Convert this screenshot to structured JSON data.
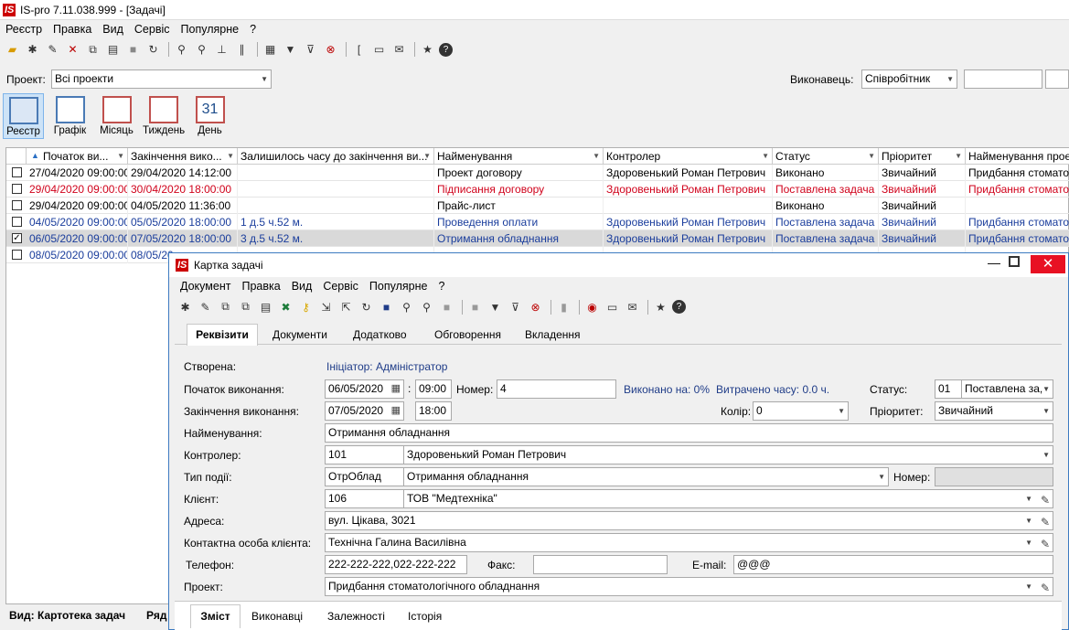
{
  "app": {
    "title": "IS-pro 7.11.038.999 - [Задачі]",
    "logo": "IS"
  },
  "menu": [
    "Реєстр",
    "Правка",
    "Вид",
    "Сервіс",
    "Популярне",
    "?"
  ],
  "toolbar_icons": [
    "new-folder-icon",
    "new-doc-icon",
    "edit-icon",
    "delete-icon",
    "copy-icon",
    "print-icon",
    "save-icon",
    "refresh-icon",
    "find-icon",
    "find-next-icon",
    "tree-icon",
    "attach-icon",
    "table-icon",
    "filter-icon",
    "filter-clear-icon",
    "filter-off-icon",
    "bracket-icon",
    "card-icon",
    "mail-icon",
    "star-icon",
    "help-icon"
  ],
  "filter": {
    "project_label": "Проект:",
    "project_value": "Всі проекти",
    "executor_label": "Виконавець:",
    "executor_value": "Співробітник"
  },
  "views": [
    "Реєстр",
    "Графік",
    "Місяць",
    "Тиждень",
    "День"
  ],
  "day_number": "31",
  "grid": {
    "headers": [
      "Початок ви...",
      "Закінчення вико...",
      "Залишилось часу до закінчення ви...",
      "Найменування",
      "Контролер",
      "Статус",
      "Пріоритет",
      "Найменування проект"
    ],
    "rows": [
      {
        "color": "#000000",
        "checked": "",
        "cells": [
          "27/04/2020 09:00:00",
          "29/04/2020 14:12:00",
          "",
          "Проект договору",
          "Здоровенький Роман Петрович",
          "Виконано",
          "Звичайний",
          "Придбання стоматоло"
        ]
      },
      {
        "color": "#d0021b",
        "checked": "",
        "cells": [
          "29/04/2020 09:00:00",
          "30/04/2020 18:00:00",
          "",
          "Підписання договору",
          "Здоровенький Роман Петрович",
          "Поставлена задача",
          "Звичайний",
          "Придбання стоматоло"
        ]
      },
      {
        "color": "#000000",
        "checked": "",
        "cells": [
          "29/04/2020 09:00:00",
          "04/05/2020 11:36:00",
          "",
          "Прайс-лист",
          "",
          "Виконано",
          "Звичайний",
          ""
        ]
      },
      {
        "color": "#1a3d9c",
        "checked": "",
        "cells": [
          "04/05/2020 09:00:00",
          "05/05/2020 18:00:00",
          "1 д.5 ч.52 м.",
          "Проведення оплати",
          "Здоровенький Роман Петрович",
          "Поставлена задача",
          "Звичайний",
          "Придбання стоматоло"
        ]
      },
      {
        "color": "#1a3d9c",
        "checked": "✓",
        "cells": [
          "06/05/2020 09:00:00",
          "07/05/2020 18:00:00",
          "3 д.5 ч.52 м.",
          "Отримання обладнання",
          "Здоровенький Роман Петрович",
          "Поставлена задача",
          "Звичайний",
          "Придбання стоматоло"
        ]
      },
      {
        "color": "#1a3d9c",
        "checked": "",
        "cells": [
          "08/05/2020 09:00:00",
          "08/05/20",
          "",
          "",
          "",
          "",
          "",
          ""
        ]
      }
    ],
    "footer_left": "Вид: Картотека задач",
    "footer_right": "Ряд"
  },
  "dialog": {
    "title": "Картка задачі",
    "menu": [
      "Документ",
      "Правка",
      "Вид",
      "Сервіс",
      "Популярне",
      "?"
    ],
    "tabs": [
      "Реквізити",
      "Документи",
      "Додатково",
      "Обговорення",
      "Вкладення"
    ],
    "bottom_tabs": [
      "Зміст",
      "Виконавці",
      "Залежності",
      "Історія"
    ],
    "created_label": "Створена:",
    "created_value": "Ініціатор: Адміністратор",
    "start_label": "Початок виконання:",
    "start_date": "06/05/2020",
    "start_time": "09:00",
    "number_label": "Номер:",
    "number_value": "4",
    "done_text": "Виконано на: 0%",
    "spent_text": "Витрачено часу: 0.0 ч.",
    "status_label": "Статус:",
    "status_code": "01",
    "status_value": "Поставлена за,",
    "end_label": "Закінчення виконання:",
    "end_date": "07/05/2020",
    "end_time": "18:00",
    "color_label": "Колір:",
    "color_value": "0",
    "priority_label": "Пріоритет:",
    "priority_value": "Звичайний",
    "name_label": "Найменування:",
    "name_value": "Отримання обладнання",
    "controller_label": "Контролер:",
    "controller_code": "101",
    "controller_name": "Здоровенький Роман Петрович",
    "event_label": "Тип події:",
    "event_code": "ОтрОблад",
    "event_name": "Отримання обладнання",
    "event_number_label": "Номер:",
    "client_label": "Клієнт:",
    "client_code": "106",
    "client_name": "ТОВ \"Медтехніка\"",
    "address_label": "Адреса:",
    "address_value": "вул. Цікава, 3021",
    "contact_label": "Контактна особа клієнта:",
    "contact_value": "Технічна Галина Василівна",
    "phone_label": "Телефон:",
    "phone_value": "222-222-222,022-222-222",
    "fax_label": "Факс:",
    "fax_value": "",
    "email_label": "E-mail:",
    "email_value": "@@@",
    "project_label": "Проект:",
    "project_value": "Придбання стоматологічного обладнання"
  }
}
